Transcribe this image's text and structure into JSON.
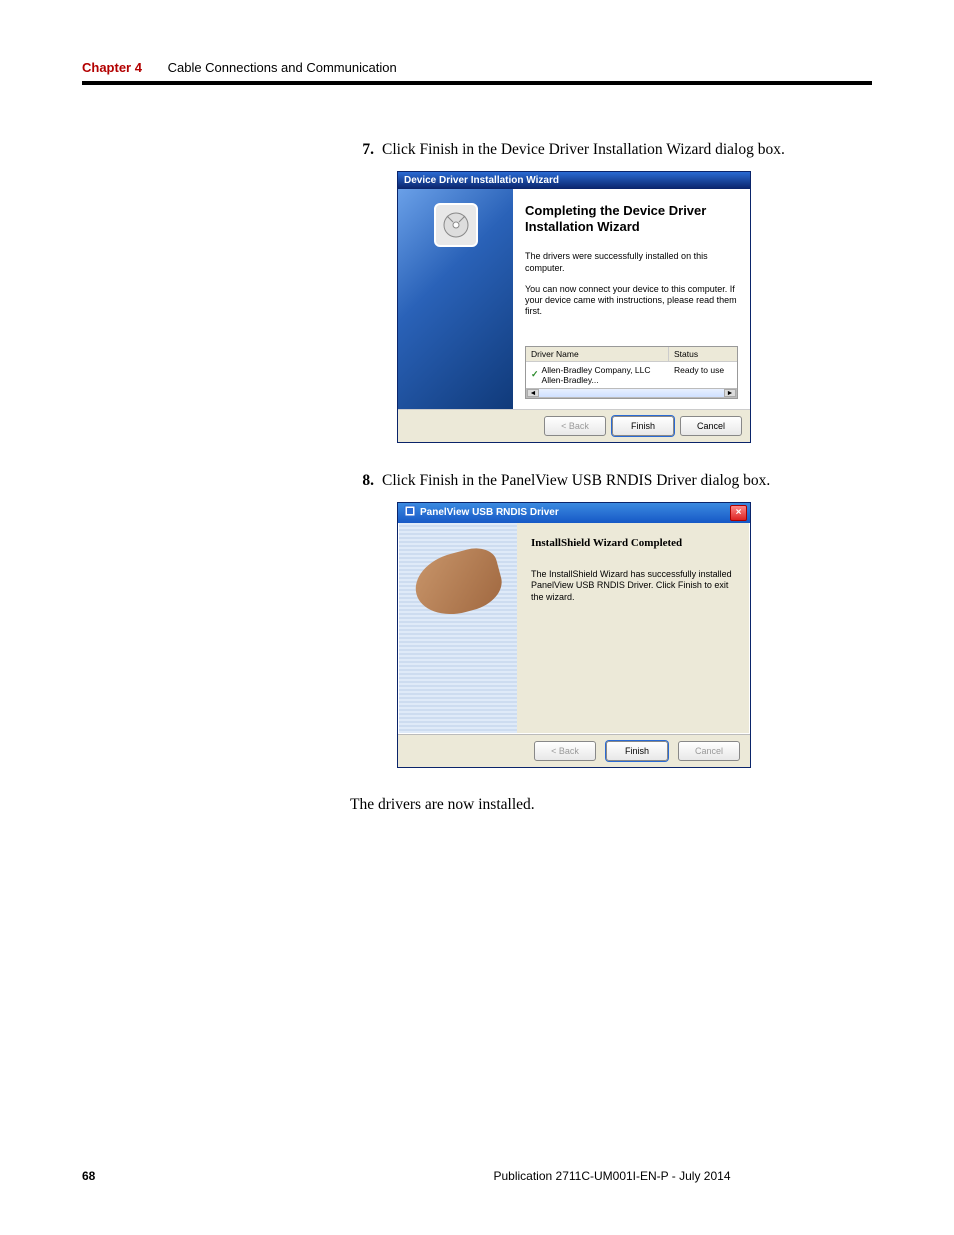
{
  "header": {
    "chapter": "Chapter 4",
    "title": "Cable Connections and Communication"
  },
  "steps": {
    "s7": {
      "num": "7.",
      "text": "Click Finish in the Device Driver Installation Wizard dialog box."
    },
    "s8": {
      "num": "8.",
      "text": "Click Finish in the PanelView USB RNDIS Driver dialog box."
    }
  },
  "dialog1": {
    "titlebar": "Device Driver Installation Wizard",
    "heading": "Completing the Device Driver Installation Wizard",
    "para1": "The drivers were successfully installed on this computer.",
    "para2": "You can now connect your device to this computer. If your device came with instructions, please read them first.",
    "col1": "Driver Name",
    "col2": "Status",
    "row1_name": "Allen-Bradley Company, LLC Allen-Bradley...",
    "row1_status": "Ready to use",
    "btn_back": "< Back",
    "btn_finish": "Finish",
    "btn_cancel": "Cancel"
  },
  "dialog2": {
    "titlebar": "PanelView USB RNDIS Driver",
    "heading": "InstallShield Wizard Completed",
    "para": "The InstallShield Wizard has successfully installed PanelView USB RNDIS Driver. Click Finish to exit the wizard.",
    "btn_back": "< Back",
    "btn_finish": "Finish",
    "btn_cancel": "Cancel"
  },
  "post": "The drivers are now installed.",
  "footer": {
    "page": "68",
    "pub": "Publication 2711C-UM001I-EN-P - July 2014"
  }
}
